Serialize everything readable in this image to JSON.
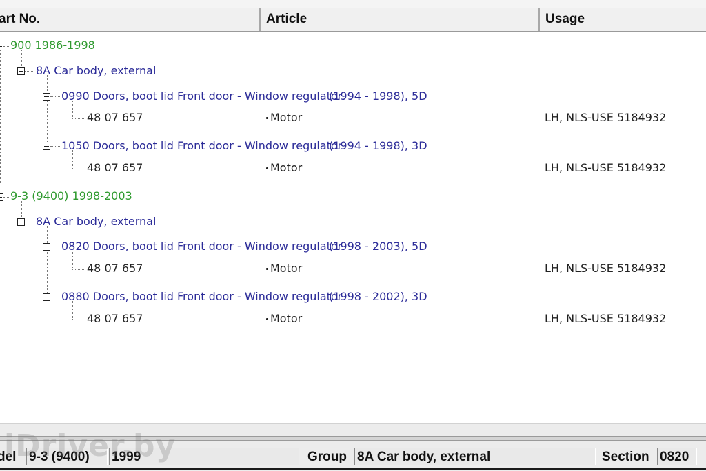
{
  "columns": {
    "part_no": "art No.",
    "article": "Article",
    "usage": "Usage"
  },
  "tree": {
    "model1": {
      "label": "900 1986-1998",
      "group": "8A Car body, external",
      "sections": [
        {
          "label": "0990 Doors, boot lid  Front door - Window regulator",
          "years": "(1994 - 1998), 5D",
          "part": "48 07 657",
          "article": "Motor",
          "usage": "LH, NLS-USE 5184932"
        },
        {
          "label": "1050 Doors, boot lid  Front door - Window regulator",
          "years": "(1994 - 1998), 3D",
          "part": "48 07 657",
          "article": "Motor",
          "usage": "LH, NLS-USE 5184932"
        }
      ]
    },
    "model2": {
      "label": "9-3 (9400) 1998-2003",
      "group": "8A Car body, external",
      "sections": [
        {
          "label": "0820 Doors, boot lid  Front door - Window regulator",
          "years": "(1998 - 2003), 5D",
          "part": "48 07 657",
          "article": "Motor",
          "usage": "LH, NLS-USE 5184932"
        },
        {
          "label": "0880 Doors, boot lid  Front door - Window regulator",
          "years": "(1998 - 2002), 3D",
          "part": "48 07 657",
          "article": "Motor",
          "usage": "LH, NLS-USE 5184932"
        }
      ]
    }
  },
  "status": {
    "model_label": "del",
    "model_value": "9-3 (9400)",
    "year_value": "1999",
    "group_label": "Group",
    "group_value": "8A Car body, external",
    "section_label": "Section",
    "section_value": "0820"
  },
  "watermark": "iDriver.by",
  "colors": {
    "model": "#2f9a2f",
    "node": "#2b2b98",
    "text": "#222222"
  }
}
